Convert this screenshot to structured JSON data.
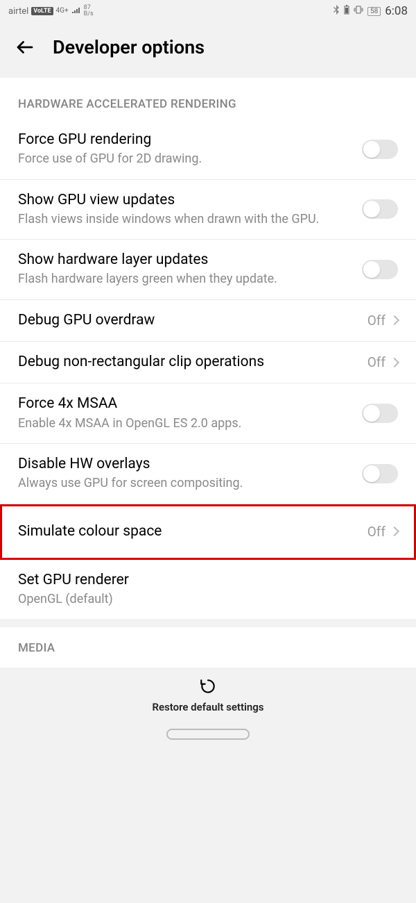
{
  "status": {
    "carrier": "airtel",
    "volte": "VoLTE",
    "net": "4G+",
    "rate_top": "87",
    "rate_bot": "B/s",
    "battery": "58",
    "time": "6:08"
  },
  "header": {
    "title": "Developer options"
  },
  "section1": "HARDWARE ACCELERATED RENDERING",
  "rows": {
    "force_gpu": {
      "title": "Force GPU rendering",
      "sub": "Force use of GPU for 2D drawing."
    },
    "show_gpu_view": {
      "title": "Show GPU view updates",
      "sub": "Flash views inside windows when drawn with the GPU."
    },
    "show_hw_layer": {
      "title": "Show hardware layer updates",
      "sub": "Flash hardware layers green when they update."
    },
    "debug_overdraw": {
      "title": "Debug GPU overdraw",
      "value": "Off"
    },
    "debug_clip": {
      "title": "Debug non-rectangular clip operations",
      "value": "Off"
    },
    "force_msaa": {
      "title": "Force 4x MSAA",
      "sub": "Enable 4x MSAA in OpenGL ES 2.0 apps."
    },
    "disable_hw": {
      "title": "Disable HW overlays",
      "sub": "Always use GPU for screen compositing."
    },
    "sim_colour": {
      "title": "Simulate colour space",
      "value": "Off"
    },
    "gpu_renderer": {
      "title": "Set GPU renderer",
      "sub": "OpenGL (default)"
    }
  },
  "section2": "MEDIA",
  "footer": {
    "restore": "Restore default settings"
  }
}
